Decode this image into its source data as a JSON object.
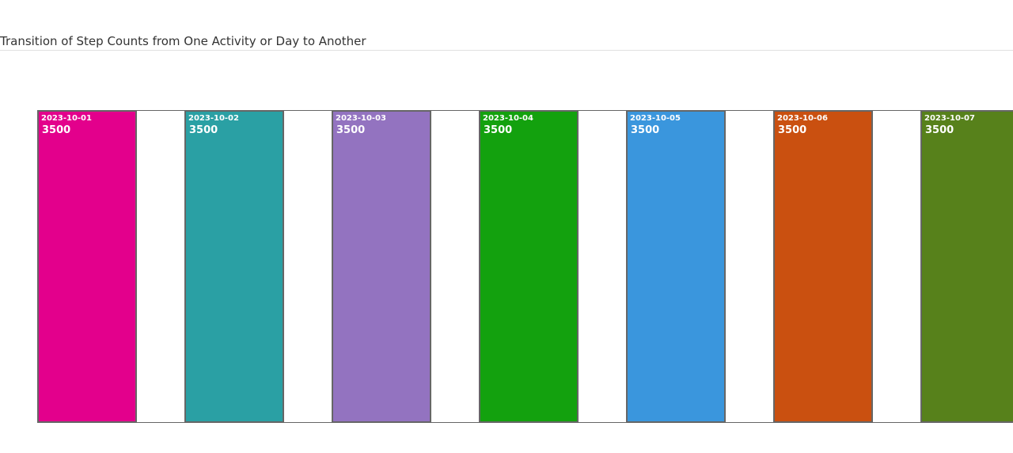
{
  "title": "Transition of Step Counts from One Activity or Day to Another",
  "chart_data": {
    "type": "sankey",
    "title": "Transition of Step Counts from One Activity or Day to Another",
    "nodes": [
      {
        "date": "2023-10-01",
        "value": 3500,
        "color": "#e3008c"
      },
      {
        "date": "2023-10-02",
        "value": 3500,
        "color": "#2aa0a4"
      },
      {
        "date": "2023-10-03",
        "value": 3500,
        "color": "#9373c0"
      },
      {
        "date": "2023-10-04",
        "value": 3500,
        "color": "#13a10e"
      },
      {
        "date": "2023-10-05",
        "value": 3500,
        "color": "#3a96dd"
      },
      {
        "date": "2023-10-06",
        "value": 3500,
        "color": "#ca5010"
      },
      {
        "date": "2023-10-07",
        "value": 3500,
        "color": "#57811b"
      }
    ],
    "links": [
      {
        "source": "2023-10-01",
        "target": "2023-10-02",
        "value": 3500
      },
      {
        "source": "2023-10-02",
        "target": "2023-10-03",
        "value": 3500
      },
      {
        "source": "2023-10-03",
        "target": "2023-10-04",
        "value": 3500
      },
      {
        "source": "2023-10-04",
        "target": "2023-10-05",
        "value": 3500
      },
      {
        "source": "2023-10-05",
        "target": "2023-10-06",
        "value": 3500
      },
      {
        "source": "2023-10-06",
        "target": "2023-10-07",
        "value": 3500
      }
    ],
    "link_color": "#ffffff"
  }
}
